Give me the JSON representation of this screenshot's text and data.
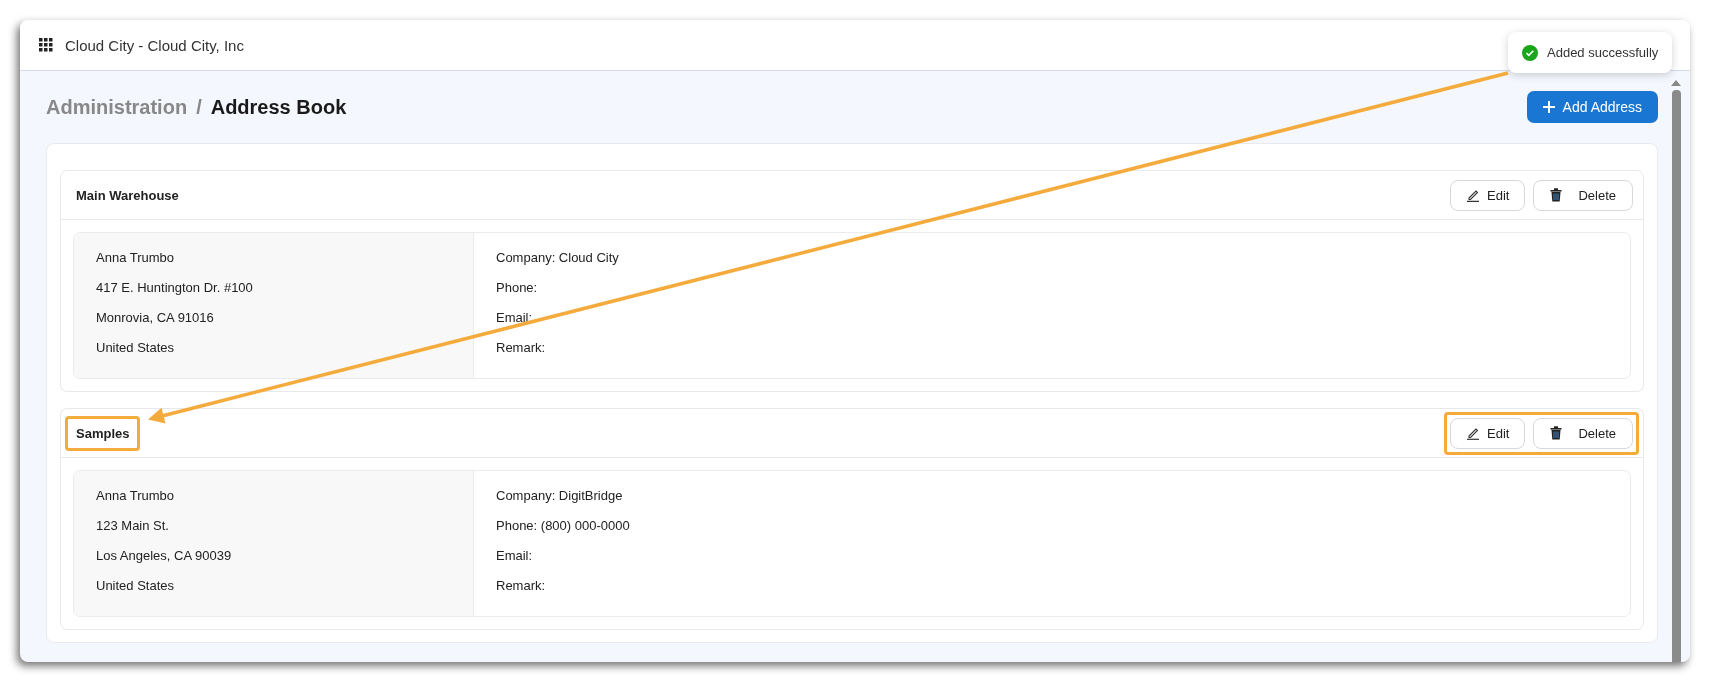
{
  "header": {
    "title": "Cloud City - Cloud City, Inc"
  },
  "toast": {
    "message": "Added successfully"
  },
  "breadcrumb": [
    {
      "label": "Administration",
      "current": false
    },
    {
      "label": "/",
      "current": false
    },
    {
      "label": "Address Book",
      "current": true
    }
  ],
  "add_button": {
    "label": "Add Address"
  },
  "addresses": [
    {
      "name": "Main Warehouse",
      "highlighted": false,
      "edit_label": "Edit",
      "delete_label": "Delete",
      "address_lines": [
        "Anna Trumbo",
        "417 E. Huntington Dr. #100",
        "Monrovia, CA 91016",
        "United States"
      ],
      "details": [
        "Company: Cloud City",
        "Phone:",
        "Email:",
        "Remark:"
      ]
    },
    {
      "name": "Samples",
      "highlighted": true,
      "edit_label": "Edit",
      "delete_label": "Delete",
      "address_lines": [
        "Anna Trumbo",
        "123 Main St.",
        "Los Angeles, CA 90039",
        "United States"
      ],
      "details": [
        "Company: DigitBridge",
        "Phone: (800) 000-0000",
        "Email:",
        "Remark:"
      ]
    }
  ],
  "annotation": {
    "arrow": true
  }
}
